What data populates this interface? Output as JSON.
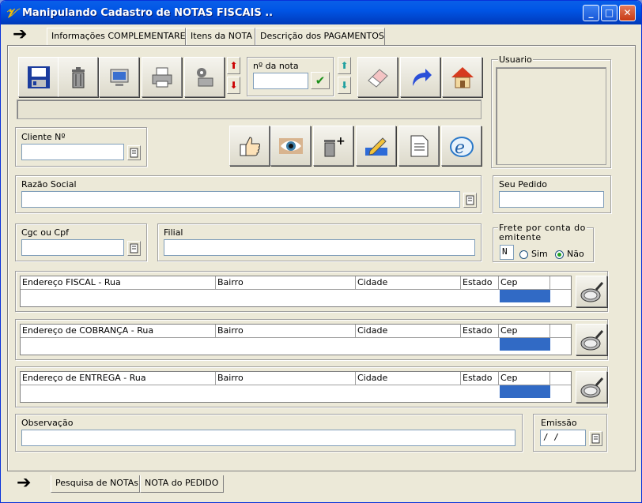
{
  "window": {
    "title": "Manipulando Cadastro de NOTAS FISCAIS ..",
    "icon": "app-logo-icon",
    "controls": {
      "minimize": "_",
      "maximize": "□",
      "close": "✕"
    }
  },
  "top_tabs": [
    "Informações COMPLEMENTARES",
    "Itens da NOTA",
    "Descrição dos PAGAMENTOS"
  ],
  "bottom_tabs": [
    "Pesquisa de NOTAs",
    "NOTA do PEDIDO"
  ],
  "toolbar": {
    "nota_label": "nº da nota",
    "nota_value": "",
    "icons": [
      "save-icon",
      "delete-icon",
      "monitor-icon",
      "printer-icon",
      "print-settings-icon",
      "eraser-icon",
      "redo-icon",
      "home-icon"
    ]
  },
  "actions": {
    "icons": [
      "thumb-icon",
      "eye-icon",
      "trash-plus-icon",
      "edit-icon",
      "document-icon",
      "nfe-icon"
    ]
  },
  "usuario": {
    "label": "Usuario"
  },
  "cliente": {
    "label": "Cliente Nº",
    "value": ""
  },
  "razao": {
    "label": "Razão Social",
    "value": ""
  },
  "seu_pedido": {
    "label": "Seu Pedido",
    "value": ""
  },
  "cgc": {
    "label": "Cgc ou Cpf",
    "value": ""
  },
  "filial": {
    "label": "Filial",
    "value": ""
  },
  "frete": {
    "label": "Frete por conta do emitente",
    "code": "N",
    "option_sim": "Sim",
    "option_nao": "Não",
    "selected": "Não"
  },
  "enderecos": [
    {
      "rua": "Endereço FISCAL - Rua",
      "bairro": "Bairro",
      "cidade": "Cidade",
      "estado": "Estado",
      "cep": "Cep"
    },
    {
      "rua": "Endereço de COBRANÇA - Rua",
      "bairro": "Bairro",
      "cidade": "Cidade",
      "estado": "Estado",
      "cep": "Cep"
    },
    {
      "rua": "Endereço de ENTREGA - Rua",
      "bairro": "Bairro",
      "cidade": "Cidade",
      "estado": "Estado",
      "cep": "Cep"
    }
  ],
  "observacao": {
    "label": "Observação",
    "value": ""
  },
  "emissao": {
    "label": "Emissão",
    "value": "/ /"
  }
}
